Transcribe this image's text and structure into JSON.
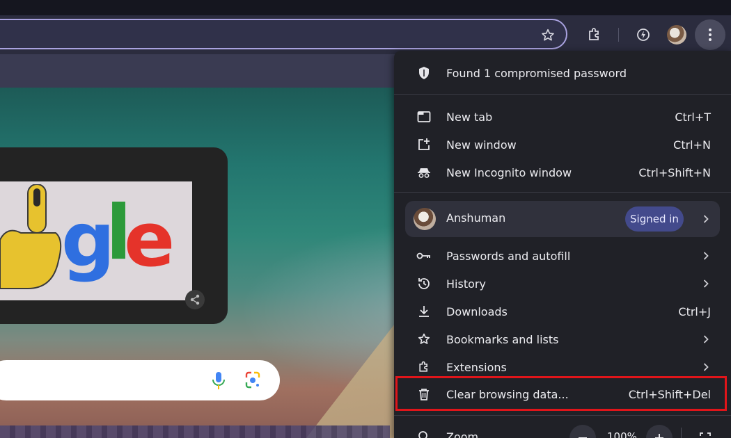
{
  "menu": {
    "alert": {
      "label": "Found 1 compromised password",
      "icon": "shield-icon"
    },
    "new_tab": {
      "label": "New tab",
      "shortcut": "Ctrl+T"
    },
    "new_window": {
      "label": "New window",
      "shortcut": "Ctrl+N"
    },
    "new_incognito": {
      "label": "New Incognito window",
      "shortcut": "Ctrl+Shift+N"
    },
    "profile": {
      "name": "Anshuman",
      "badge": "Signed in"
    },
    "passwords": {
      "label": "Passwords and autofill"
    },
    "history": {
      "label": "History"
    },
    "downloads": {
      "label": "Downloads",
      "shortcut": "Ctrl+J"
    },
    "bookmarks": {
      "label": "Bookmarks and lists"
    },
    "extensions": {
      "label": "Extensions"
    },
    "clear_data": {
      "label": "Clear browsing data...",
      "shortcut": "Ctrl+Shift+Del"
    },
    "zoom": {
      "label": "Zoom",
      "value": "100%"
    }
  },
  "doodle": {
    "letters": [
      "g",
      "l",
      "e"
    ]
  },
  "colors": {
    "highlight": "#e0151a",
    "badge_bg": "#434a8c",
    "menu_bg": "#202127"
  }
}
